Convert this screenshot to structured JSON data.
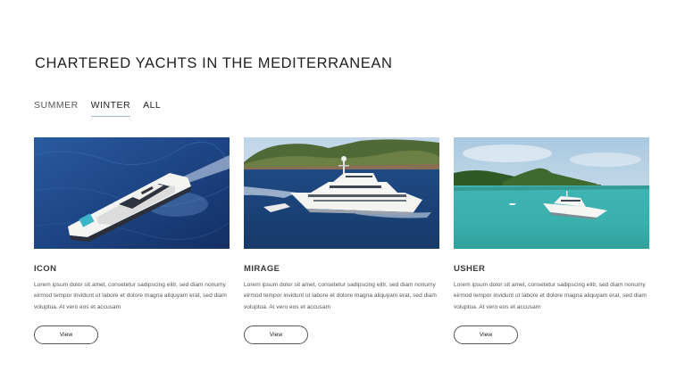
{
  "page": {
    "title": "CHARTERED YACHTS IN THE MEDITERRANEAN"
  },
  "tabs": [
    {
      "label": "SUMMER",
      "active": false
    },
    {
      "label": "WINTER",
      "active": true
    },
    {
      "label": "ALL",
      "active": false
    }
  ],
  "cards": [
    {
      "name": "ICON",
      "description": "Lorem ipsum dolor sit amet, consetetur sadipscing elitr, sed diam nonumy eirmod tempor invidunt ut labore et dolore magna aliquyam erat, sed diam voluptua. At vero eos et accusam",
      "button_label": "View"
    },
    {
      "name": "MIRAGE",
      "description": "Lorem ipsum dolor sit amet, consetetur sadipscing elitr, sed diam nonumy eirmod tempor invidunt ut labore et dolore magna aliquyam erat, sed diam voluptua. At vero eos et accusam",
      "button_label": "View"
    },
    {
      "name": "USHER",
      "description": "Lorem ipsum dolor sit amet, consetetur sadipscing elitr, sed diam nonumy eirmod tempor invidunt ut labore et dolore magna aliquyam erat, sed diam voluptua. At vero eos et accusam",
      "button_label": "View"
    }
  ],
  "colors": {
    "tab_underline": "#9db6c4",
    "deep_sea": "#1d3f78",
    "lagoon": "#3bb6b0"
  }
}
